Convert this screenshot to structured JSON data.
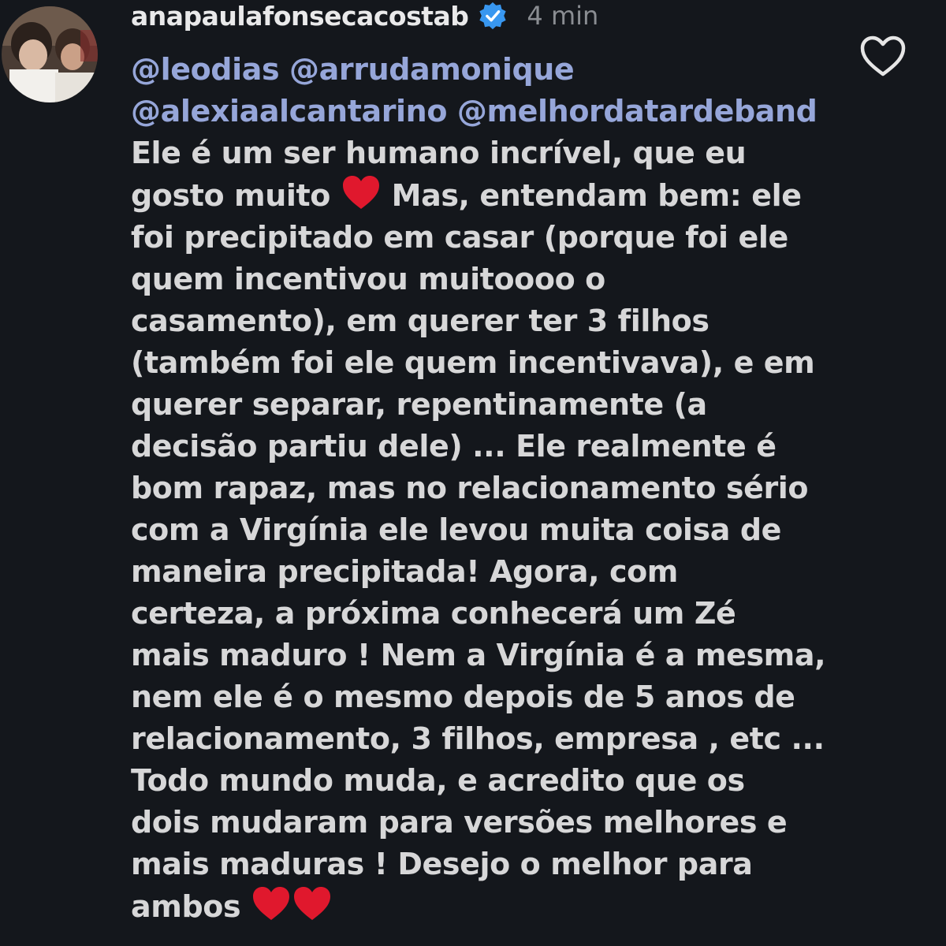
{
  "comment": {
    "username": "anapaulafonsecacostab",
    "time": "4 min",
    "mentions": [
      "@leodias",
      "@arrudamonique",
      "@alexiaalcantarino",
      "@melhordatardeband"
    ],
    "lines": [
      "Ele é um ser humano incrível, que eu",
      "gosto muito",
      "Mas, entendam bem: ele",
      "foi precipitado em casar (porque foi ele",
      "quem incentivou muitoooo o",
      "casamento), em querer ter 3 filhos",
      "(também foi ele quem incentivava), e em",
      "querer separar, repentinamente (a",
      "decisão partiu dele) ... Ele realmente é",
      "bom rapaz, mas no relacionamento sério",
      "com a Virgínia ele levou muita coisa de",
      "maneira precipitada! Agora, com",
      "certeza, a próxima conhecerá um Zé",
      "mais maduro ! Nem a Virgínia é a mesma,",
      "nem ele é o mesmo depois de 5 anos de",
      "relacionamento, 3 filhos, empresa , etc ...",
      "Todo mundo muda, e acredito que os",
      "dois mudaram para versões melhores e",
      "mais maduras ! Desejo o melhor para",
      "ambos"
    ],
    "icons": {
      "verified": "verified-badge-icon",
      "like": "heart-outline-icon",
      "emoji": "red-heart-emoji"
    },
    "colors": {
      "background": "#14171c",
      "text": "#d7d7d8",
      "mention": "#96a6d9",
      "verified": "#3897f0",
      "emoji": "#e0182d"
    }
  }
}
